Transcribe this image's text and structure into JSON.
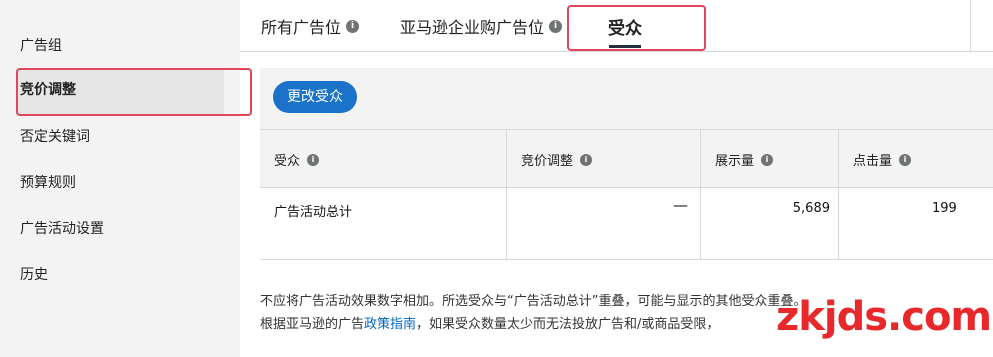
{
  "sidebar": {
    "items": [
      {
        "label": "广告组"
      },
      {
        "label": "竞价调整"
      },
      {
        "label": "否定关键词"
      },
      {
        "label": "预算规则"
      },
      {
        "label": "广告活动设置"
      },
      {
        "label": "历史"
      }
    ]
  },
  "tabs": {
    "items": [
      {
        "label": "所有广告位"
      },
      {
        "label": "亚马逊企业购广告位"
      },
      {
        "label": "受众"
      }
    ],
    "info_glyph": "i"
  },
  "toolbar": {
    "change_audience_label": "更改受众"
  },
  "table": {
    "headers": [
      "受众",
      "竞价调整",
      "展示量",
      "点击量"
    ],
    "rows": [
      {
        "audience": "广告活动总计",
        "bid_adjustment": "—",
        "impressions": "5,689",
        "clicks": "199"
      }
    ]
  },
  "footnote": {
    "line1": "不应将广告活动效果数字相加。所选受众与“广告活动总计”重叠，可能与显示的其他受众重叠。",
    "line2_before": "根据亚马逊的广告",
    "line2_link": "政策指南",
    "line2_after": "，如果受众数量太少而无法投放广告和/或商品受限，"
  },
  "watermark": {
    "text": "zkjds.com"
  },
  "colors": {
    "accent": "#1a73c9",
    "highlight_border": "#e0475e",
    "watermark": "#e8282b",
    "link": "#0066c0"
  }
}
